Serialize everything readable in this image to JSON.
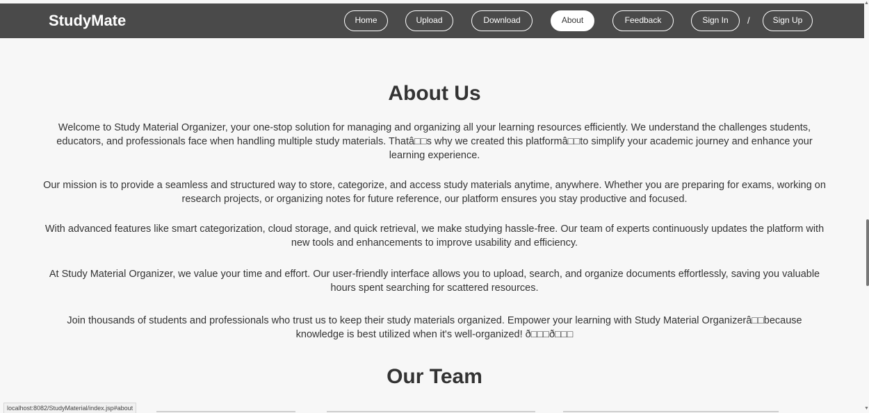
{
  "header": {
    "brand": "StudyMate",
    "nav": [
      "Home",
      "Upload",
      "Download",
      "About",
      "Feedback",
      "Sign In",
      "Sign Up"
    ],
    "active": "About",
    "separator": "/"
  },
  "about": {
    "title": "About Us",
    "paragraphs": [
      "Welcome to Study Material Organizer, your one-stop solution for managing and organizing all your learning resources efficiently. We understand the challenges students, educators, and professionals face when handling multiple study materials. Thatâ□□s why we created this platformâ□□to simplify your academic journey and enhance your learning experience.",
      "Our mission is to provide a seamless and structured way to store, categorize, and access study materials anytime, anywhere. Whether you are preparing for exams, working on research projects, or organizing notes for future reference, our platform ensures you stay productive and focused.",
      "With advanced features like smart categorization, cloud storage, and quick retrieval, we make studying hassle-free. Our team of experts continuously updates the platform with new tools and enhancements to improve usability and efficiency.",
      "At Study Material Organizer, we value your time and effort. Our user-friendly interface allows you to upload, search, and organize documents effortlessly, saving you valuable hours spent searching for scattered resources.",
      "Join thousands of students and professionals who trust us to keep their study materials organized. Empower your learning with Study Material Organizerâ□□because knowledge is best utilized when it's well-organized! ð□□□ð□□□"
    ]
  },
  "team": {
    "title": "Our Team"
  },
  "status_bar": {
    "url": "localhost:8082/StudyMaterial/index.jsp#about"
  },
  "colors": {
    "header_bg": "#4a4a4a",
    "page_bg": "#f7f7f7",
    "text": "#333333"
  },
  "icons": {
    "scroll_up": "chevron-up-icon",
    "scroll_down": "chevron-down-icon"
  }
}
